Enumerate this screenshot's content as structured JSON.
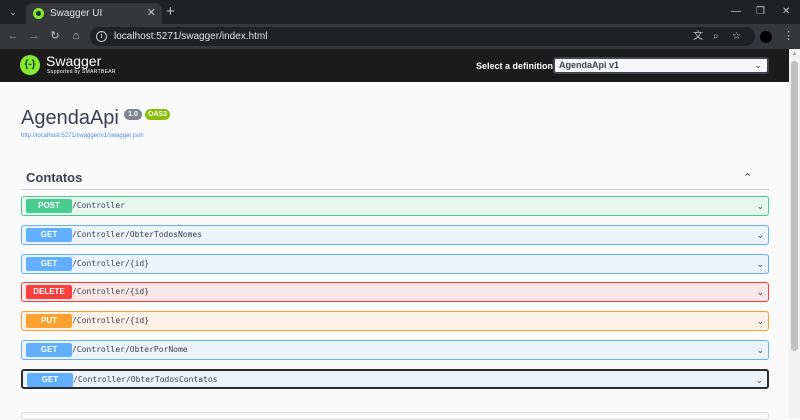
{
  "browser": {
    "tab_title": "Swagger UI",
    "tab_close": "✕",
    "new_tab": "+",
    "url": "localhost:5271/swagger/index.html"
  },
  "topbar": {
    "logo_text": "Swagger",
    "logo_sub": "Supported by SMARTBEAR",
    "definition_label": "Select a definition",
    "definition_value": "AgendaApi v1"
  },
  "info": {
    "title": "AgendaApi",
    "version": "1.0",
    "oas": "OAS3",
    "spec_url": "http://localhost:5271/swagger/v1/swagger.json"
  },
  "tag": {
    "name": "Contatos",
    "operations": [
      {
        "method": "POST",
        "path": "/Controller",
        "color": "#49cc90",
        "bg": "#e8f6f0",
        "border": "#49cc90"
      },
      {
        "method": "GET",
        "path": "/Controller/ObterTodosNomes",
        "color": "#61affe",
        "bg": "#ebf3fb",
        "border": "#61affe"
      },
      {
        "method": "GET",
        "path": "/Controller/{id}",
        "color": "#61affe",
        "bg": "#ebf3fb",
        "border": "#61affe"
      },
      {
        "method": "DELETE",
        "path": "/Controller/{id}",
        "color": "#f93e3e",
        "bg": "#fae7e7",
        "border": "#f93e3e"
      },
      {
        "method": "PUT",
        "path": "/Controller/{id}",
        "color": "#fca130",
        "bg": "#fbf1e6",
        "border": "#fca130"
      },
      {
        "method": "GET",
        "path": "/Controller/ObterPorNome",
        "color": "#61affe",
        "bg": "#ebf3fb",
        "border": "#61affe"
      },
      {
        "method": "GET",
        "path": "/Controller/ObterTodosContatos",
        "color": "#61affe",
        "bg": "#ebf3fb",
        "border": "#61affe"
      }
    ]
  }
}
